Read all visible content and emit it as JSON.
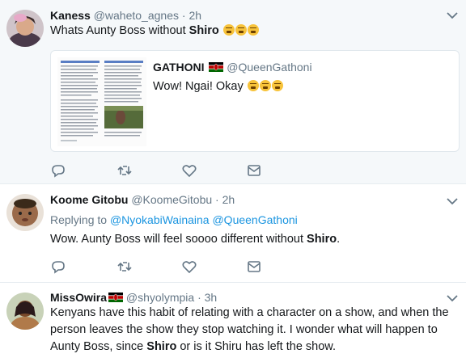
{
  "tweets": [
    {
      "author_name": "Kaness",
      "handle": "@waheto_agnes",
      "separator": "·",
      "time": "2h",
      "text_before": "Whats Aunty Boss without ",
      "text_bold": "Shiro",
      "emoji": "😩😩😩",
      "quoted": {
        "author_name": "GATHONI",
        "flag": "kenya-flag",
        "handle": "@QueenGathoni",
        "text": "Wow! Ngai! Okay ",
        "emoji": "😩😩😩"
      }
    },
    {
      "author_name": "Koome Gitobu",
      "handle": "@KoomeGitobu",
      "separator": "·",
      "time": "2h",
      "replying_prefix": "Replying to ",
      "replying_to_1": "@NyokabiWainaina",
      "replying_to_2": "@QueenGathoni",
      "text_before": "Wow. Aunty Boss will feel soooo different without ",
      "text_bold": "Shiro",
      "text_after": "."
    },
    {
      "author_name": "MissOwira",
      "flag": "kenya-flag",
      "handle": "@shyolympia",
      "separator": "·",
      "time": "3h",
      "text_before": "Kenyans have this habit of relating with a character on a show, and when the person leaves the show they stop watching it. I wonder what will happen to Aunty Boss, since ",
      "text_bold": "Shiro",
      "text_after": " or is it Shiru has left the show."
    }
  ],
  "icons": {
    "reply": "reply-icon",
    "retweet": "retweet-icon",
    "like": "heart-icon",
    "dm": "envelope-icon",
    "menu": "chevron-down-icon"
  },
  "colors": {
    "link": "#1b95e0",
    "muted": "#657786",
    "divider": "#e6ecf0",
    "highlight_bg": "#f5f8fa"
  }
}
